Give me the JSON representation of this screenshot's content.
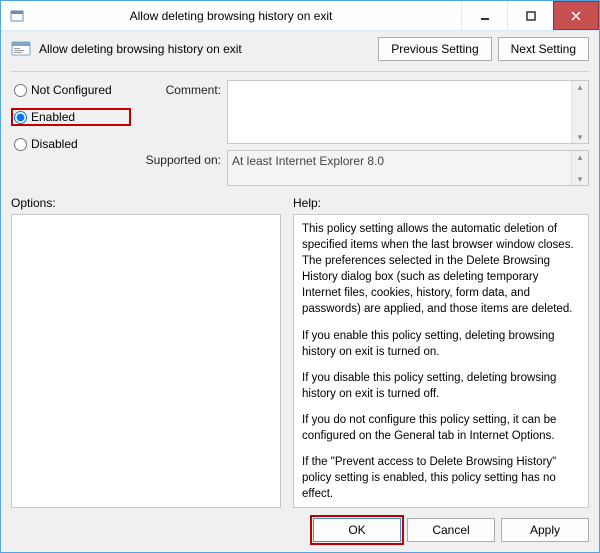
{
  "window": {
    "title": "Allow deleting browsing history on exit"
  },
  "header": {
    "title": "Allow deleting browsing history on exit",
    "prev_btn": "Previous Setting",
    "next_btn": "Next Setting"
  },
  "radios": {
    "not_configured": "Not Configured",
    "enabled": "Enabled",
    "disabled": "Disabled"
  },
  "labels": {
    "comment": "Comment:",
    "supported": "Supported on:",
    "options": "Options:",
    "help": "Help:"
  },
  "values": {
    "comment": "",
    "supported": "At least Internet Explorer 8.0"
  },
  "help": {
    "p1": "This policy setting allows the automatic deletion of specified items when the last browser window closes. The preferences selected in the Delete Browsing History dialog box (such as deleting temporary Internet files, cookies, history, form data, and passwords) are applied, and those items are deleted.",
    "p2": "If you enable this policy setting, deleting browsing history on exit is turned on.",
    "p3": "If you disable this policy setting, deleting browsing history on exit is turned off.",
    "p4": "If you do not configure this policy setting, it can be configured on the General tab in Internet Options.",
    "p5": "If the \"Prevent access to Delete Browsing History\" policy setting is enabled, this policy setting has no effect."
  },
  "footer": {
    "ok": "OK",
    "cancel": "Cancel",
    "apply": "Apply"
  }
}
